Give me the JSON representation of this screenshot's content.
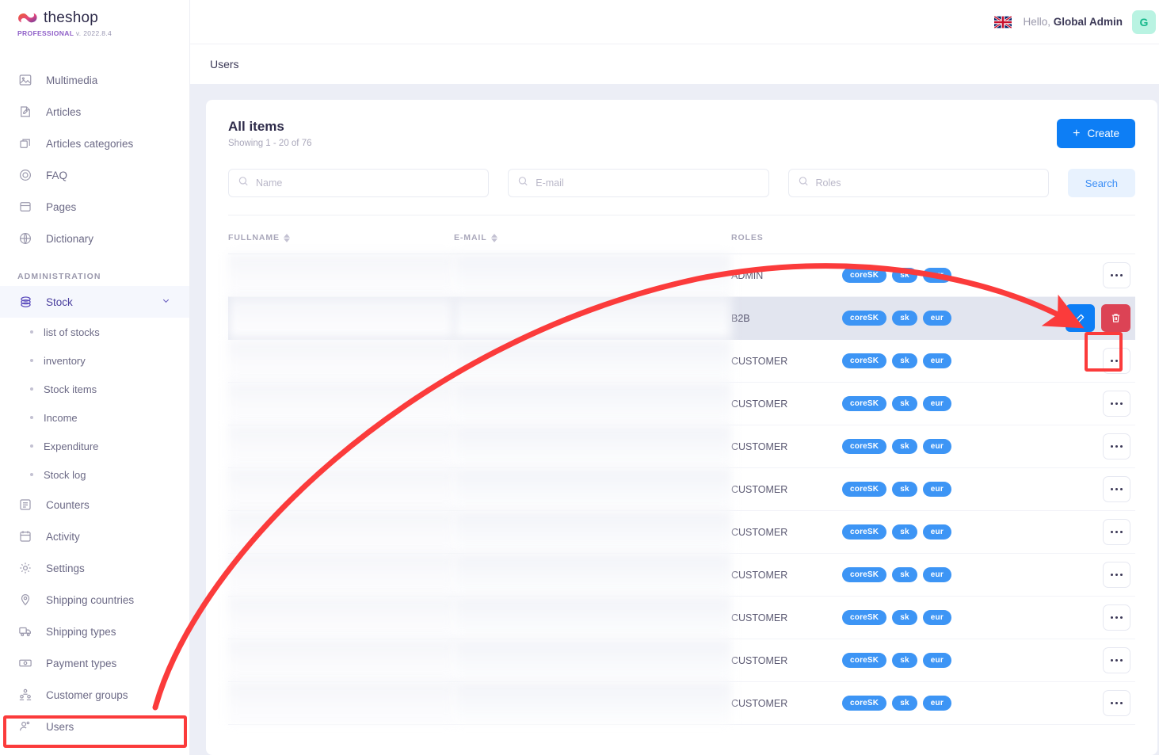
{
  "brand": {
    "name": "theshop",
    "edition": "PROFESSIONAL",
    "version": "v. 2022.8.4",
    "logo_gradient_from": "#f2602e",
    "logo_gradient_to": "#6b3fa0"
  },
  "topbar": {
    "flag_icon": "uk-flag-icon",
    "greeting_prefix": "Hello,",
    "user_name": "Global Admin",
    "avatar_initial": "G",
    "avatar_bg": "#b9f3e2",
    "avatar_color": "#16b98c"
  },
  "page": {
    "title": "Users"
  },
  "sidebar": {
    "items": [
      {
        "label": "Multimedia",
        "icon": "image-icon"
      },
      {
        "label": "Articles",
        "icon": "article-icon"
      },
      {
        "label": "Articles categories",
        "icon": "layers-icon"
      },
      {
        "label": "FAQ",
        "icon": "question-circle-icon"
      },
      {
        "label": "Pages",
        "icon": "window-icon"
      },
      {
        "label": "Dictionary",
        "icon": "globe-icon"
      }
    ],
    "section_label": "ADMINISTRATION",
    "stock": {
      "label": "Stock",
      "icon": "box-icon",
      "expanded": true,
      "chevron_icon": "chevron-down-icon",
      "children": [
        {
          "label": "list of stocks"
        },
        {
          "label": "inventory"
        },
        {
          "label": "Stock items"
        },
        {
          "label": "Income"
        },
        {
          "label": "Expenditure"
        },
        {
          "label": "Stock log"
        }
      ]
    },
    "admin_items": [
      {
        "label": "Counters",
        "icon": "list-icon"
      },
      {
        "label": "Activity",
        "icon": "calendar-icon"
      },
      {
        "label": "Settings",
        "icon": "gear-icon"
      },
      {
        "label": "Shipping countries",
        "icon": "map-pin-icon"
      },
      {
        "label": "Shipping types",
        "icon": "truck-icon"
      },
      {
        "label": "Payment types",
        "icon": "banknote-icon"
      },
      {
        "label": "Customer groups",
        "icon": "users-group-icon"
      },
      {
        "label": "Users",
        "icon": "user-cog-icon"
      }
    ]
  },
  "card": {
    "title": "All items",
    "subtitle": "Showing 1 - 20 of 76",
    "create_label": "Create",
    "create_icon": "plus-icon",
    "create_bg": "#0d7ef5"
  },
  "filters": {
    "search_icon": "search-icon",
    "name": {
      "value": "",
      "placeholder": "Name"
    },
    "email": {
      "value": "",
      "placeholder": "E-mail"
    },
    "roles": {
      "value": "",
      "placeholder": "Roles"
    },
    "search_label": "Search",
    "search_bg": "#e8f2fe",
    "search_color": "#3b8ef6"
  },
  "table": {
    "columns": [
      {
        "key": "fullname",
        "label": "FULLNAME",
        "sortable": true
      },
      {
        "key": "email",
        "label": "E-MAIL",
        "sortable": true
      },
      {
        "key": "roles",
        "label": "ROLES",
        "sortable": false
      },
      {
        "key": "badges",
        "label": "",
        "sortable": false
      },
      {
        "key": "actions",
        "label": "",
        "sortable": false
      }
    ],
    "badge_color": "#3d95f5",
    "rows": [
      {
        "fullname": "",
        "email": "",
        "redacted": true,
        "role": "ADMIN",
        "badges": [
          "coreSK",
          "sk",
          "eur"
        ],
        "selected": false,
        "actions": "menu"
      },
      {
        "fullname": "",
        "email": "",
        "redacted": true,
        "role": "B2B",
        "badges": [
          "coreSK",
          "sk",
          "eur"
        ],
        "selected": true,
        "actions": "edit-delete"
      },
      {
        "fullname": "",
        "email": "",
        "redacted": true,
        "role": "CUSTOMER",
        "badges": [
          "coreSK",
          "sk",
          "eur"
        ],
        "selected": false,
        "actions": "menu"
      },
      {
        "fullname": "",
        "email": "",
        "redacted": true,
        "role": "CUSTOMER",
        "badges": [
          "coreSK",
          "sk",
          "eur"
        ],
        "selected": false,
        "actions": "menu"
      },
      {
        "fullname": "",
        "email": "",
        "redacted": true,
        "role": "CUSTOMER",
        "badges": [
          "coreSK",
          "sk",
          "eur"
        ],
        "selected": false,
        "actions": "menu"
      },
      {
        "fullname": "",
        "email": "",
        "redacted": true,
        "role": "CUSTOMER",
        "badges": [
          "coreSK",
          "sk",
          "eur"
        ],
        "selected": false,
        "actions": "menu"
      },
      {
        "fullname": "",
        "email": "",
        "redacted": true,
        "role": "CUSTOMER",
        "badges": [
          "coreSK",
          "sk",
          "eur"
        ],
        "selected": false,
        "actions": "menu"
      },
      {
        "fullname": "",
        "email": "",
        "redacted": true,
        "role": "CUSTOMER",
        "badges": [
          "coreSK",
          "sk",
          "eur"
        ],
        "selected": false,
        "actions": "menu"
      },
      {
        "fullname": "",
        "email": "",
        "redacted": true,
        "role": "CUSTOMER",
        "badges": [
          "coreSK",
          "sk",
          "eur"
        ],
        "selected": false,
        "actions": "menu"
      },
      {
        "fullname": "",
        "email": "",
        "redacted": true,
        "role": "CUSTOMER",
        "badges": [
          "coreSK",
          "sk",
          "eur"
        ],
        "selected": false,
        "actions": "menu"
      },
      {
        "fullname": "",
        "email": "",
        "redacted": true,
        "role": "CUSTOMER",
        "badges": [
          "coreSK",
          "sk",
          "eur"
        ],
        "selected": false,
        "actions": "menu"
      }
    ],
    "row_actions": {
      "menu_icon": "ellipsis-icon",
      "edit_icon": "edit-icon",
      "delete_icon": "trash-icon",
      "edit_bg": "#0d7ef5",
      "delete_bg": "#dc4355"
    }
  },
  "annotations": {
    "color": "#fb3b3b",
    "highlight_users_nav": true,
    "highlight_delete_button": true,
    "arrow_from": "users-sidebar-item",
    "arrow_to": "delete-button"
  }
}
